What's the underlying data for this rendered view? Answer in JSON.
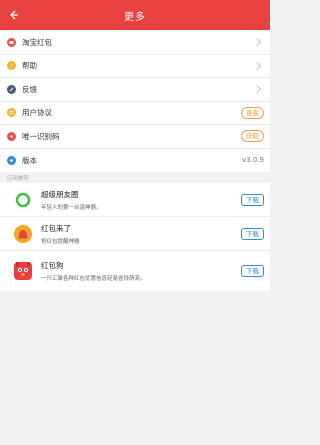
{
  "header": {
    "title": "更多"
  },
  "menu": [
    {
      "label": "淘宝红包",
      "color": "#ef4c4a",
      "trail": "chevron"
    },
    {
      "label": "帮助",
      "color": "#f0b52a",
      "trail": "chevron"
    },
    {
      "label": "反馈",
      "color": "#4a5a7b",
      "trail": "chevron"
    },
    {
      "label": "用户协议",
      "color": "#f0b52a",
      "trail": "pill",
      "pill": "查看"
    },
    {
      "label": "唯一识别码",
      "color": "#ef4c4a",
      "trail": "pill",
      "pill": "获取"
    },
    {
      "label": "版本",
      "color": "#2a8fd6",
      "trail": "text",
      "value": "v3.0.9"
    }
  ],
  "section": {
    "label": "应用推荐"
  },
  "apps": [
    {
      "name": "超级朋友圈",
      "desc": "年轻人的第一台温神器。",
      "button": "下载"
    },
    {
      "name": "红包来了",
      "desc": "抢红包提醒神器",
      "button": "下载"
    },
    {
      "name": "红包狗",
      "desc": "一只汇聚各种红包优惠信息轻易省钱萌宠。",
      "button": "下载"
    }
  ],
  "colors": {
    "brand": "#e9413f",
    "link": "#2a8fd6",
    "accent": "#e9a33b"
  }
}
